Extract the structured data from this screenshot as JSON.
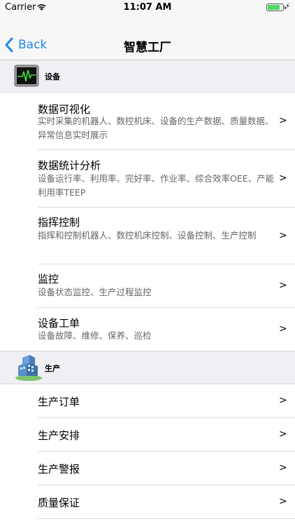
{
  "status_bar": {
    "carrier": "Carrier",
    "time": "11:07 AM"
  },
  "nav": {
    "back_label": "Back",
    "title": "智慧工厂"
  },
  "sections": [
    {
      "header": "设备",
      "icon": "monitor-icon",
      "rows": [
        {
          "title": "数据可视化",
          "desc": "实时采集的机器人、数控机床、设备的生产数据、质量数据、异常信息实时展示",
          "chevron": ">"
        },
        {
          "title": "数据统计分析",
          "desc": "设备运行率、利用率、完好率、作业率、综合效率OEE、产能利用率TEEP",
          "chevron": ">"
        },
        {
          "title": "指挥控制",
          "desc": "指挥和控制机器人、数控机床控制、设备控制、生产控制",
          "chevron": ">"
        },
        {
          "title": "监控",
          "desc": "设备状态监控、生产过程监控",
          "chevron": ">"
        },
        {
          "title": "设备工单",
          "desc": "设备故障、维修、保养、巡检",
          "chevron": ">"
        }
      ]
    },
    {
      "header": "生产",
      "icon": "factory-building-icon",
      "rows": [
        {
          "title": "生产订单",
          "chevron": ">"
        },
        {
          "title": "生产安排",
          "chevron": ">"
        },
        {
          "title": "生产警报",
          "chevron": ">"
        },
        {
          "title": "质量保证",
          "chevron": ">"
        }
      ]
    }
  ],
  "colors": {
    "accent": "#1f86f0",
    "section_bg": "#efeff4",
    "battery": "#4cd964"
  }
}
